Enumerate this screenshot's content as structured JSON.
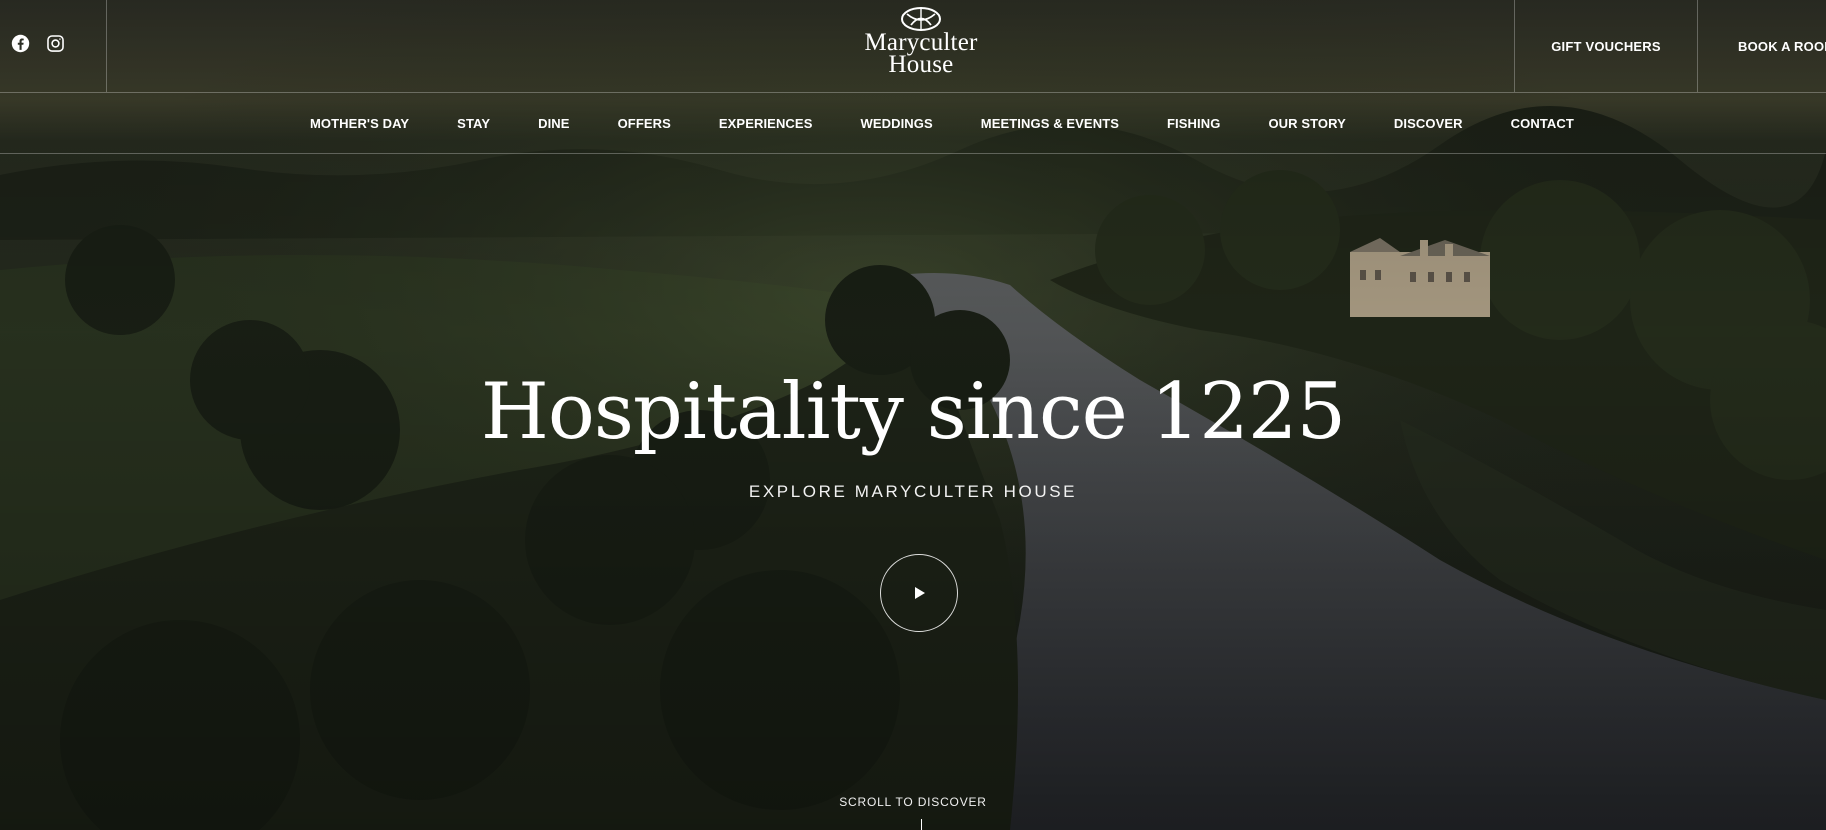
{
  "header": {
    "social": [
      {
        "name": "facebook",
        "icon": "facebook-icon"
      },
      {
        "name": "instagram",
        "icon": "instagram-icon"
      }
    ],
    "logo": {
      "line1": "Maryculter",
      "line2": "House",
      "mark_icon": "crest-icon"
    },
    "gift_vouchers_label": "GIFT VOUCHERS",
    "book_room_label": "BOOK A ROOM"
  },
  "nav": {
    "items": [
      "MOTHER'S DAY",
      "STAY",
      "DINE",
      "OFFERS",
      "EXPERIENCES",
      "WEDDINGS",
      "MEETINGS & EVENTS",
      "FISHING",
      "OUR STORY",
      "DISCOVER",
      "CONTACT"
    ]
  },
  "hero": {
    "title": "Hospitality since 1225",
    "subtitle": "EXPLORE MARYCULTER HOUSE",
    "play_icon": "play-icon",
    "scroll_hint": "SCROLL TO DISCOVER",
    "background_description_icon": "aerial-river-photo"
  },
  "colors": {
    "text": "#ffffff",
    "divider": "rgba(255,255,255,0.28)",
    "forest_dark": "#1f2219",
    "river": "#4a4d52"
  }
}
